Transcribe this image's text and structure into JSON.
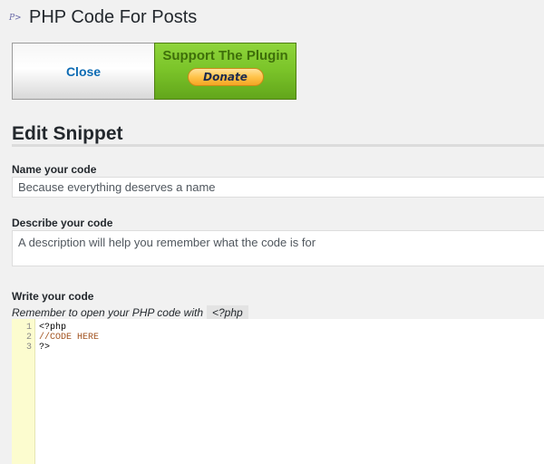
{
  "header": {
    "title": "PHP Code For Posts",
    "icon": "php-code-icon"
  },
  "buttons": {
    "close_label": "Close",
    "support_label": "Support The Plugin",
    "donate_label": "Donate"
  },
  "section": {
    "title": "Edit Snippet"
  },
  "form": {
    "name_label": "Name your code",
    "name_placeholder": "Because everything deserves a name",
    "describe_label": "Describe your code",
    "describe_placeholder": "A description will help you remember what the code is for",
    "code_label": "Write your code",
    "code_hint": "Remember to open your PHP code with",
    "code_hint_tag": "<?php"
  },
  "editor": {
    "line_numbers": [
      "1",
      "2",
      "3"
    ],
    "lines": [
      "<?php",
      "//CODE HERE",
      "?>"
    ]
  },
  "colors": {
    "support_green": "#7cc52a",
    "donate_orange": "#ffc34a",
    "close_blue": "#0d6bb3",
    "gutter_yellow": "#fcfccf",
    "comment_brown": "#a0511d"
  }
}
